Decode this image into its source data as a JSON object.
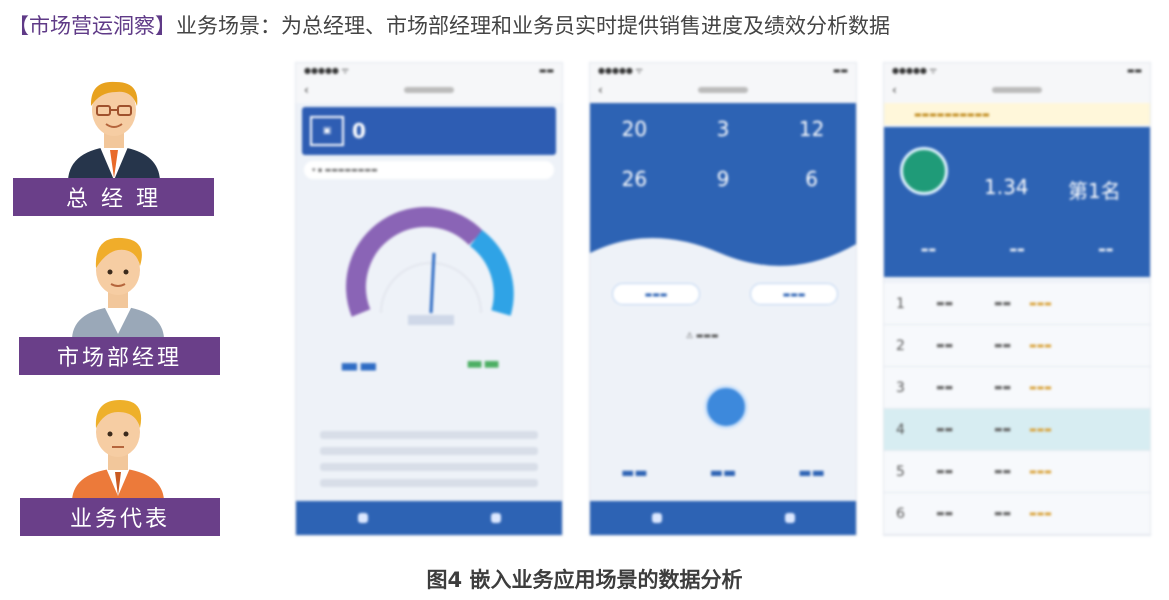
{
  "header": {
    "tag": "【市场营运洞察】",
    "description": "业务场景：为总经理、市场部经理和业务员实时提供销售进度及绩效分析数据"
  },
  "roles": [
    {
      "label": "总 经 理"
    },
    {
      "label": "市场部经理"
    },
    {
      "label": "业务代表"
    }
  ],
  "phone2": {
    "stats": [
      "20",
      "3",
      "12",
      "26",
      "9",
      "6"
    ]
  },
  "phone3": {
    "score": "1.34",
    "rank": "第1名",
    "rows": [
      "1",
      "2",
      "3",
      "4",
      "5",
      "6"
    ]
  },
  "caption": "图4  嵌入业务应用场景的数据分析",
  "colors": {
    "role_box": "#6a3f89",
    "app_blue": "#2d63b4",
    "gauge_purple": "#8a64b6",
    "gauge_blue": "#2fa3e6"
  }
}
